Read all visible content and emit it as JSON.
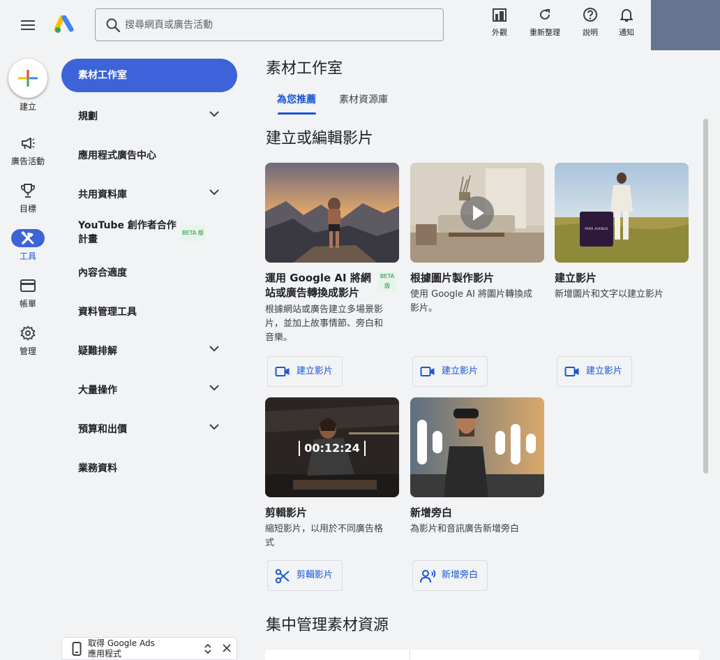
{
  "topbar": {
    "search_placeholder": "搜尋網頁或廣告活動",
    "tools": [
      {
        "label": "外觀",
        "icon": "appearance-icon"
      },
      {
        "label": "重新整理",
        "icon": "refresh-icon"
      },
      {
        "label": "說明",
        "icon": "help-icon"
      },
      {
        "label": "通知",
        "icon": "bell-icon"
      }
    ],
    "account_color": "#66758f"
  },
  "rail": {
    "create_label": "建立",
    "items": [
      {
        "label": "廣告活動",
        "icon": "megaphone-icon"
      },
      {
        "label": "目標",
        "icon": "trophy-icon"
      },
      {
        "label": "工具",
        "icon": "tools-icon",
        "active": true
      },
      {
        "label": "帳單",
        "icon": "credit-card-icon"
      },
      {
        "label": "管理",
        "icon": "gear-icon"
      }
    ]
  },
  "nav": {
    "active": "素材工作室",
    "items": [
      {
        "label": "規劃",
        "expandable": true
      },
      {
        "label": "應用程式廣告中心",
        "expandable": false
      },
      {
        "label": "共用資料庫",
        "expandable": true
      },
      {
        "label_line1": "YouTube 創作者合作",
        "label_line2": "計畫",
        "badge": "BETA 版"
      },
      {
        "label": "內容合適度",
        "expandable": false
      },
      {
        "label": "資料管理工具",
        "expandable": false
      },
      {
        "label": "疑難排解",
        "expandable": true
      },
      {
        "label": "大量操作",
        "expandable": true
      },
      {
        "label": "預算和出價",
        "expandable": true
      },
      {
        "label": "業務資料",
        "expandable": false
      }
    ],
    "get_app_line1": "取得 Google Ads",
    "get_app_line2": "應用程式"
  },
  "main": {
    "title": "素材工作室",
    "tabs": [
      {
        "label": "為您推薦",
        "active": true
      },
      {
        "label": "素材資源庫",
        "active": false
      }
    ],
    "section1_title": "建立或編輯影片",
    "section2_title": "集中管理素材資源",
    "cards": [
      {
        "title_line1": "運用 Google AI 將網",
        "title_line2": "站或廣告轉換成影片",
        "badge_line1": "BETA",
        "badge_line2": "版",
        "desc_lines": [
          "根據網站或廣告建立多場景影",
          "片，並加上故事情節、旁白和",
          "音樂。"
        ],
        "button": "建立影片",
        "button_icon": "video-camera-icon",
        "image": "mountain-hiker-image"
      },
      {
        "title_line1": "根據圖片製作影片",
        "desc_lines": [
          "使用 Google AI 將圖片轉換成",
          "影片。"
        ],
        "button": "建立影片",
        "button_icon": "video-camera-icon",
        "image": "living-room-video-image"
      },
      {
        "title_line1": "建立影片",
        "desc_lines": [
          "新增圖片和文字以建立影片"
        ],
        "button": "建立影片",
        "button_icon": "video-camera-icon",
        "image": "woman-in-field-image",
        "image_text": "PARK AVENUE"
      },
      {
        "title_line1": "剪輯影片",
        "desc_lines": [
          "縮短影片，以用於不同廣告格",
          "式"
        ],
        "button": "剪輯影片",
        "button_icon": "scissors-icon",
        "image": "fitness-woman-image",
        "image_text": "00:12:24"
      },
      {
        "title_line1": "新增旁白",
        "desc_lines": [
          "為影片和音訊廣告新增旁白"
        ],
        "button": "新增旁白",
        "button_icon": "voice-over-icon",
        "image": "man-with-soundwave-image"
      }
    ]
  }
}
